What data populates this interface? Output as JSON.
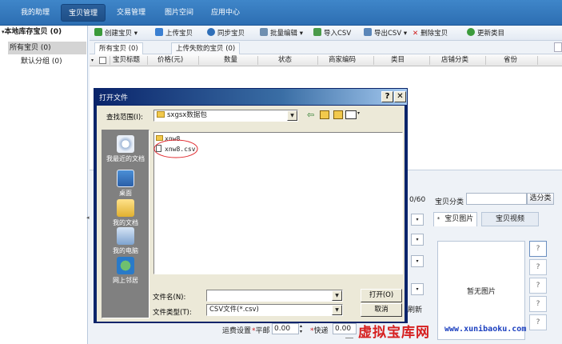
{
  "topnav": {
    "tabs": [
      {
        "label": "我的助理"
      },
      {
        "label": "宝贝管理"
      },
      {
        "label": "交易管理"
      },
      {
        "label": "图片空间"
      },
      {
        "label": "应用中心"
      }
    ]
  },
  "sidebar": {
    "root": "本地库存宝贝 (0)",
    "items": [
      {
        "label": "所有宝贝 (0)"
      },
      {
        "label": "默认分组 (0)"
      }
    ]
  },
  "toolbar": {
    "create": "创建宝贝",
    "upload": "上传宝贝",
    "sync": "同步宝贝",
    "batch": "批量编辑",
    "import": "导入CSV",
    "export": "导出CSV",
    "delete": "删除宝贝",
    "update_category": "更新类目"
  },
  "subtabs": [
    "所有宝贝 (0)",
    "上传失败的宝贝 (0)"
  ],
  "table": {
    "columns": [
      "宝贝标题",
      "价格(元)",
      "数量",
      "状态",
      "商家编码",
      "类目",
      "店铺分类",
      "省份"
    ]
  },
  "lowerpanel": {
    "count": "0/60",
    "category_label": "宝贝分类",
    "select_category": "选分类",
    "tab_pictures": "宝贝图片",
    "tab_video": "宝贝视频",
    "no_picture": "暂无图片",
    "q_marks": [
      "?",
      "?",
      "?",
      "?",
      "?"
    ],
    "shipping_label": "运费设置",
    "ping_label": "平邮",
    "ping_value": "0.00",
    "kuai_label": "快递",
    "kuai_value": "0.00",
    "refresh": "刷新"
  },
  "dialog": {
    "title": "打开文件",
    "lookin_label": "查找范围(I):",
    "lookin_value": "sxgsx数据包",
    "places": [
      "我最近的文档",
      "桌面",
      "我的文档",
      "我的电脑",
      "网上邻居"
    ],
    "files": [
      {
        "name": "xnw8",
        "type": "folder"
      },
      {
        "name": "xnw8.csv",
        "type": "file"
      }
    ],
    "filename_label": "文件名(N):",
    "filename_value": "",
    "filetype_label": "文件类型(T):",
    "filetype_value": "CSV文件(*.csv)",
    "open_button": "打开(O)",
    "cancel_button": "取消"
  },
  "watermark": {
    "cn": "虚拟宝库网",
    "url": "www.xunibaoku.com"
  },
  "colors": {
    "nav_bg": "#2d6eb2",
    "title_bar": "#0a246a",
    "dialog_bg": "#ece9d8",
    "watermark_red": "#d61f1f",
    "circle_red": "#e0282d"
  }
}
